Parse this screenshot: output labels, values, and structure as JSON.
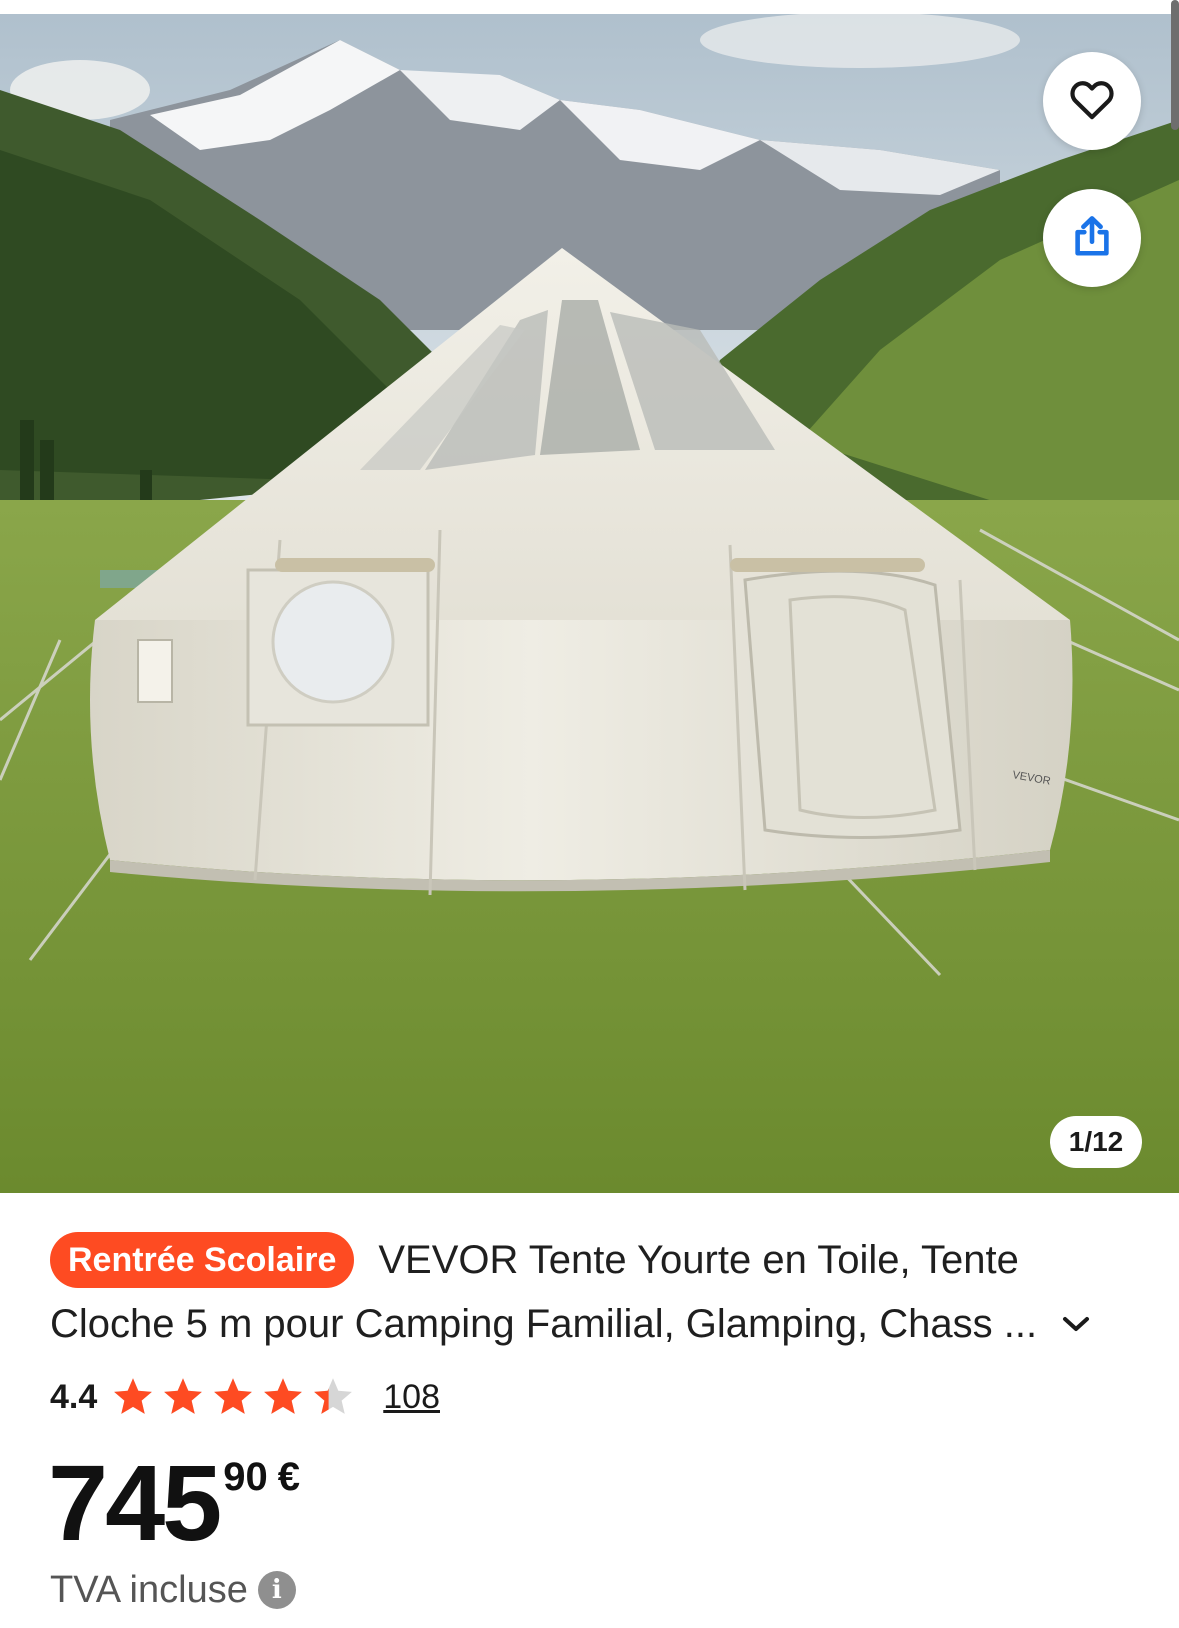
{
  "gallery": {
    "image_counter": "1/12",
    "favorite_icon": "heart-outline-icon",
    "share_icon": "share-icon"
  },
  "product": {
    "badge": "Rentrée Scolaire",
    "title_line1": "VEVOR Tente Yourte en Toile, Tente",
    "title_line2": "Cloche 5 m pour Camping Familial, Glamping, Chass",
    "title_ellipsis": "...",
    "rating": "4.4",
    "stars_value": 4.4,
    "stars_max": 5,
    "review_count": "108",
    "price_integer": "745",
    "price_decimal": "90",
    "price_currency": "€",
    "vat_note": "TVA incluse",
    "info_icon_glyph": "i"
  },
  "colors": {
    "badge_bg": "#fe4b22",
    "star_color": "#fe4b22",
    "share_icon_color": "#1a73e8"
  }
}
